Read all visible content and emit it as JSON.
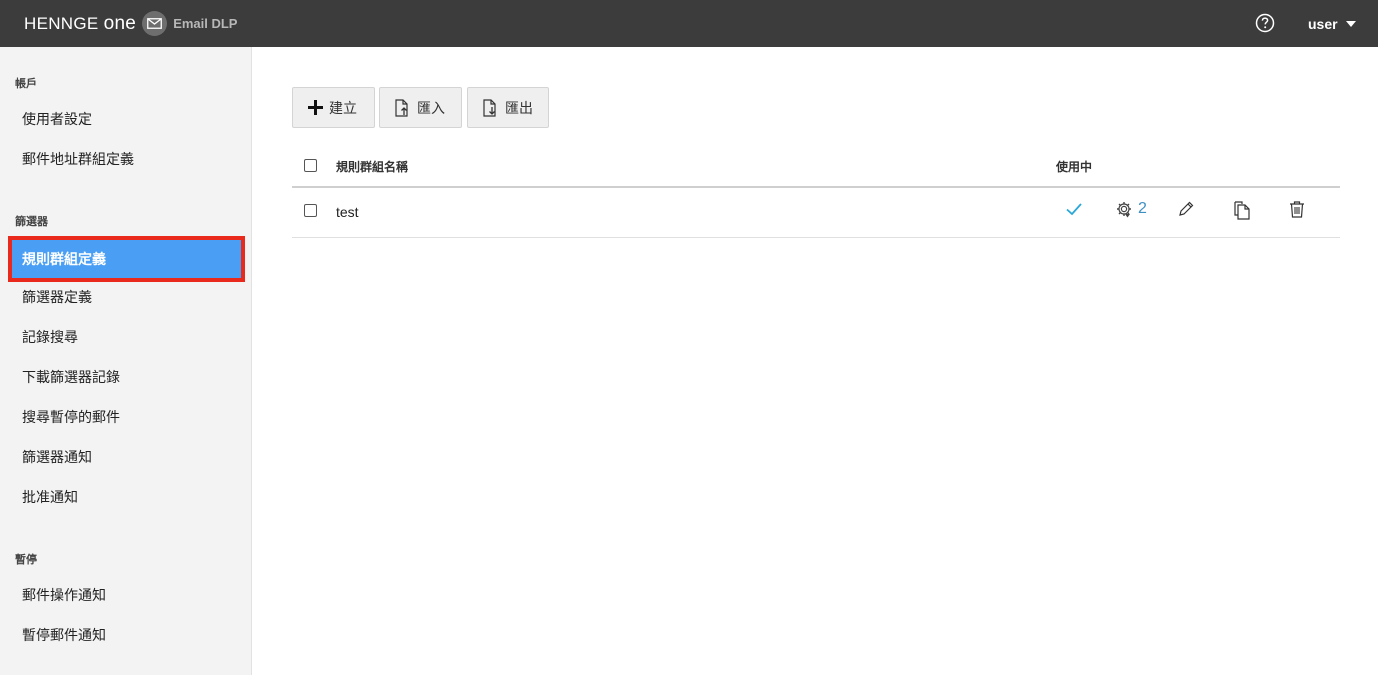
{
  "header": {
    "brand": "HENNGE",
    "brand_suffix": "one",
    "product": "Email DLP",
    "user": "user",
    "icons": {
      "mail": "envelope-icon",
      "help": "question-circle-icon",
      "caret": "caret-down-icon"
    }
  },
  "sidebar": {
    "sections": [
      {
        "title": "帳戶",
        "items": [
          "使用者設定",
          "郵件地址群組定義"
        ]
      },
      {
        "title": "篩選器",
        "items": [
          "規則群組定義",
          "篩選器定義",
          "記錄搜尋",
          "下載篩選器記錄",
          "搜尋暫停的郵件",
          "篩選器通知",
          "批准通知"
        ]
      },
      {
        "title": "暫停",
        "items": [
          "郵件操作通知",
          "暫停郵件通知"
        ]
      }
    ],
    "active_item": "規則群組定義"
  },
  "toolbar": {
    "create_label": "建立",
    "import_label": "匯入",
    "export_label": "匯出"
  },
  "table": {
    "columns": {
      "name": "規則群組名稱",
      "in_use": "使用中"
    },
    "rows": [
      {
        "name": "test",
        "in_use": true,
        "rule_count": "2"
      }
    ]
  },
  "colors": {
    "topbar": "#3c3c3c",
    "active_bg": "#4a9ff5",
    "highlight": "#e8291c",
    "check": "#29a8d8",
    "link": "#3f8fc4"
  }
}
